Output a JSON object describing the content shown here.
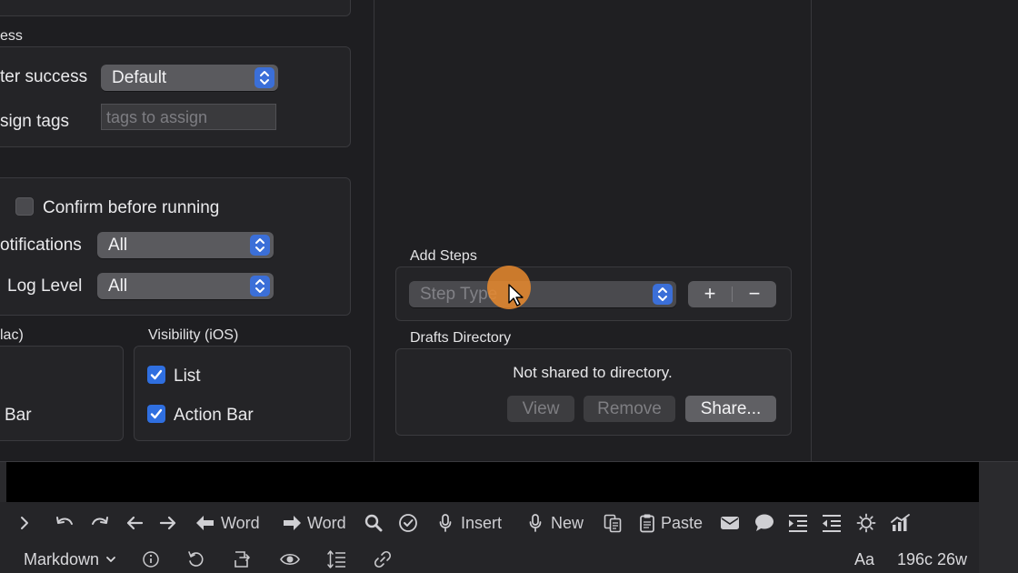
{
  "left": {
    "section_header_top": "ess",
    "after_success_label": "ter success",
    "after_success_value": "Default",
    "assign_tags_label": "sign tags",
    "assign_tags_placeholder": "tags to assign",
    "confirm_label": "Confirm before running",
    "confirm_checked": false,
    "notifications_label": "otifications",
    "notifications_value": "All",
    "log_level_label": "Log Level",
    "log_level_value": "All",
    "visibility_mac_header": "lac)",
    "visibility_mac_bar": "Bar",
    "visibility_ios_header": "Visibility (iOS)",
    "ios_list_label": "List",
    "ios_list_checked": true,
    "ios_action_bar_label": "Action Bar",
    "ios_action_bar_checked": true
  },
  "middle": {
    "add_steps_header": "Add Steps",
    "step_type_placeholder": "Step Type",
    "add_label": "+",
    "remove_label": "−",
    "drafts_dir_header": "Drafts Directory",
    "drafts_dir_status": "Not shared to directory.",
    "view_label": "View",
    "remove_btn_label": "Remove",
    "share_label": "Share..."
  },
  "toolbar": {
    "word_back": "Word",
    "word_fwd": "Word",
    "insert": "Insert",
    "new": "New",
    "paste": "Paste"
  },
  "status": {
    "mode": "Markdown",
    "font_label": "Aa",
    "counts": "196c 26w"
  },
  "colors": {
    "accent": "#3b6fd8",
    "cursor": "#e9892e"
  }
}
